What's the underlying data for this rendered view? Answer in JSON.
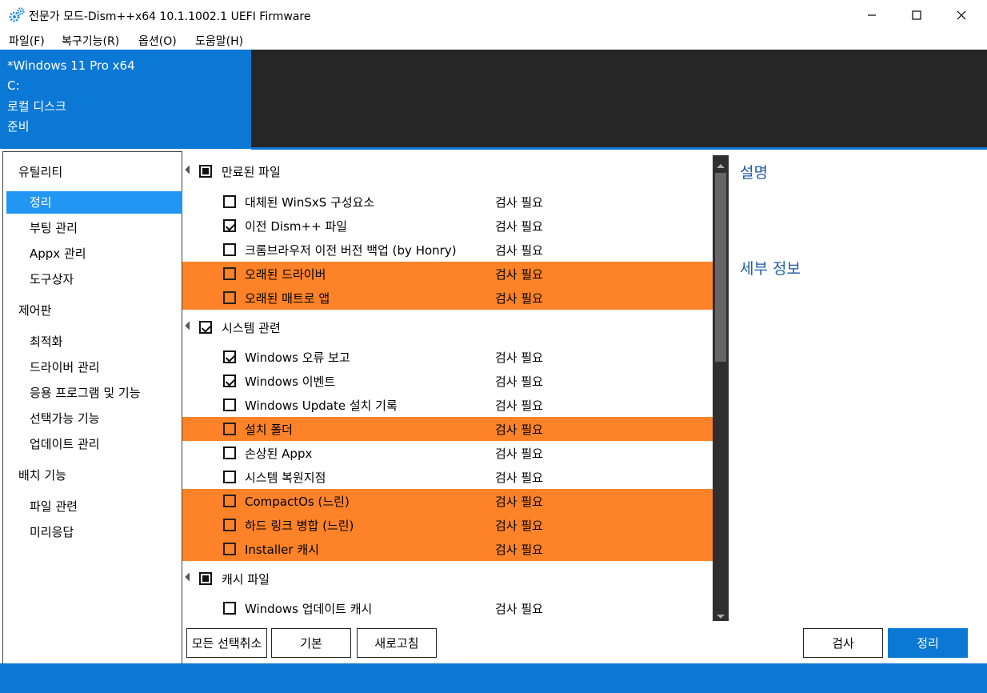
{
  "window": {
    "title": "전문가 모드-Dism++x64 10.1.1002.1 UEFI Firmware"
  },
  "menu": [
    "파일(F)",
    "복구기능(R)",
    "옵션(O)",
    "도움말(H)"
  ],
  "header": {
    "os": "*Windows 11 Pro x64",
    "drive": "C:",
    "disk": "로컬 디스크",
    "status": "준비"
  },
  "sidebar": {
    "utilities": "유틸리티",
    "cleanup": "정리",
    "boot": "부팅 관리",
    "appx": "Appx 관리",
    "toolbox": "도구상자",
    "control_panel": "제어판",
    "optimize": "최적화",
    "driver": "드라이버 관리",
    "programs": "응용 프로그램 및 기능",
    "optional": "선택가능 기능",
    "update": "업데이트 관리",
    "deploy": "배치 기능",
    "file_assoc": "파일 관련",
    "answer": "미리응답"
  },
  "groups": [
    {
      "label": "만료된 파일",
      "state": "partial",
      "items": [
        {
          "label": "대체된 WinSxS 구성요소",
          "status": "검사 필요",
          "checked": false,
          "highlight": false
        },
        {
          "label": "이전 Dism++ 파일",
          "status": "검사 필요",
          "checked": true,
          "highlight": false
        },
        {
          "label": "크롬브라우저 이전 버전 백업 (by Honry)",
          "status": "검사 필요",
          "checked": false,
          "highlight": false
        },
        {
          "label": "오래된 드라이버",
          "status": "검사 필요",
          "checked": false,
          "highlight": true
        },
        {
          "label": "오래된 매트로 앱",
          "status": "검사 필요",
          "checked": false,
          "highlight": true
        }
      ]
    },
    {
      "label": "시스템 관련",
      "state": "checked",
      "items": [
        {
          "label": "Windows 오류 보고",
          "status": "검사 필요",
          "checked": true,
          "highlight": false
        },
        {
          "label": "Windows 이벤트",
          "status": "검사 필요",
          "checked": true,
          "highlight": false
        },
        {
          "label": "Windows Update 설치 기록",
          "status": "검사 필요",
          "checked": false,
          "highlight": false
        },
        {
          "label": "설치 폴더",
          "status": "검사 필요",
          "checked": false,
          "highlight": true
        },
        {
          "label": "손상된 Appx",
          "status": "검사 필요",
          "checked": false,
          "highlight": false
        },
        {
          "label": "시스템 복원지점",
          "status": "검사 필요",
          "checked": false,
          "highlight": false
        },
        {
          "label": "CompactOs (느린)",
          "status": "검사 필요",
          "checked": false,
          "highlight": true
        },
        {
          "label": "하드 링크 병합 (느린)",
          "status": "검사 필요",
          "checked": false,
          "highlight": true
        },
        {
          "label": "Installer 캐시",
          "status": "검사 필요",
          "checked": false,
          "highlight": true
        }
      ]
    },
    {
      "label": "캐시 파일",
      "state": "partial",
      "items": [
        {
          "label": "Windows 업데이트 캐시",
          "status": "검사 필요",
          "checked": false,
          "highlight": false
        }
      ]
    }
  ],
  "panel": {
    "description": "설명",
    "details": "세부 정보"
  },
  "buttons": {
    "deselect_all": "모든 선택취소",
    "default": "기본",
    "refresh": "새로고침",
    "scan": "검사",
    "clean": "정리"
  },
  "colors": {
    "accent": "#0a78d4",
    "highlight": "#fd8228",
    "selected": "#2196f3",
    "header_dark": "#262626"
  }
}
